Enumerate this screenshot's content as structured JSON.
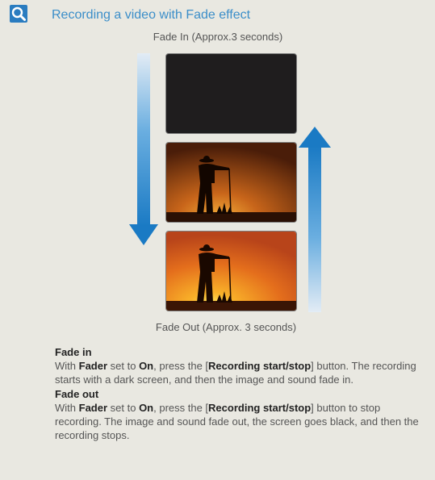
{
  "header": {
    "title": "Recording a video with Fade effect"
  },
  "diagram": {
    "top_caption": "Fade In (Approx.3 seconds)",
    "bottom_caption": "Fade Out (Approx. 3 seconds)",
    "colors": {
      "arrow": "#1f7ec6",
      "frame_dark": "#1f1d1e",
      "sunset_orange": "#e07a1e"
    }
  },
  "fade_in": {
    "heading": "Fade in",
    "t1": "With ",
    "b1": "Fader",
    "t2": " set to ",
    "b2": "On",
    "t3": ", press the [",
    "b3": "Recording start/stop",
    "t4": "] button. The recording starts with a dark screen, and then the image and sound fade in."
  },
  "fade_out": {
    "heading": "Fade out",
    "t1": "With ",
    "b1": "Fader",
    "t2": " set to ",
    "b2": "On",
    "t3": ", press the [",
    "b3": "Recording start/stop",
    "t4": "] button to stop recording. The image and sound fade out, the screen goes black, and then the recording stops."
  }
}
